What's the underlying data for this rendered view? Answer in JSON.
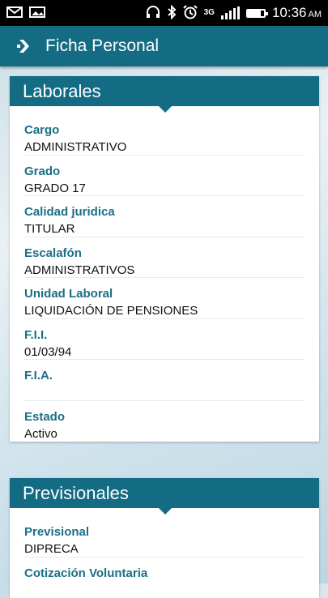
{
  "status_bar": {
    "time": "10:36",
    "ampm": "AM",
    "network": "3G",
    "icons": [
      "email-icon",
      "image-icon",
      "headphones-icon",
      "bluetooth-icon",
      "alarm-icon",
      "signal-icon",
      "battery-icon"
    ]
  },
  "app_bar": {
    "title": "Ficha Personal"
  },
  "laborales": {
    "title": "Laborales",
    "fields": [
      {
        "label": "Cargo",
        "value": "ADMINISTRATIVO"
      },
      {
        "label": "Grado",
        "value": "GRADO 17"
      },
      {
        "label": "Calidad juridica",
        "value": "TITULAR"
      },
      {
        "label": "Escalafón",
        "value": "ADMINISTRATIVOS"
      },
      {
        "label": "Unidad Laboral",
        "value": "LIQUIDACIÓN DE PENSIONES"
      },
      {
        "label": "F.I.I.",
        "value": "01/03/94"
      },
      {
        "label": "F.I.A.",
        "value": ""
      },
      {
        "label": "Estado",
        "value": "Activo"
      }
    ]
  },
  "previsionales": {
    "title": "Previsionales",
    "fields": [
      {
        "label": "Previsional",
        "value": "DIPRECA"
      },
      {
        "label": "Cotización Voluntaria",
        "value": ""
      }
    ]
  },
  "colors": {
    "primary": "#146b84",
    "label": "#1a6f86"
  }
}
